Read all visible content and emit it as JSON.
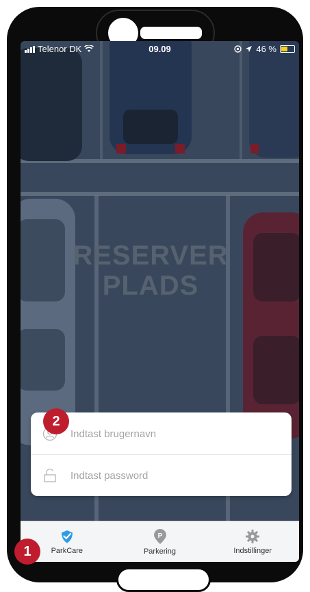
{
  "status_bar": {
    "carrier": "Telenor DK",
    "time": "09.09",
    "battery": "46 %"
  },
  "background": {
    "painted_text_line1": "RESERVER",
    "painted_text_line2": "PLADS"
  },
  "login": {
    "username_placeholder": "Indtast brugernavn",
    "password_placeholder": "Indtast password"
  },
  "tabs": [
    {
      "label": "ParkCare",
      "icon": "parkcare-check-icon",
      "active": true
    },
    {
      "label": "Parkering",
      "icon": "parking-pin-icon",
      "active": false
    },
    {
      "label": "Indstillinger",
      "icon": "gear-icon",
      "active": false
    }
  ],
  "annotations": {
    "badge1": "1",
    "badge2": "2"
  },
  "colors": {
    "accent": "#2e9be6",
    "badge": "#bf1d2e",
    "tint": "#2d3e55"
  }
}
